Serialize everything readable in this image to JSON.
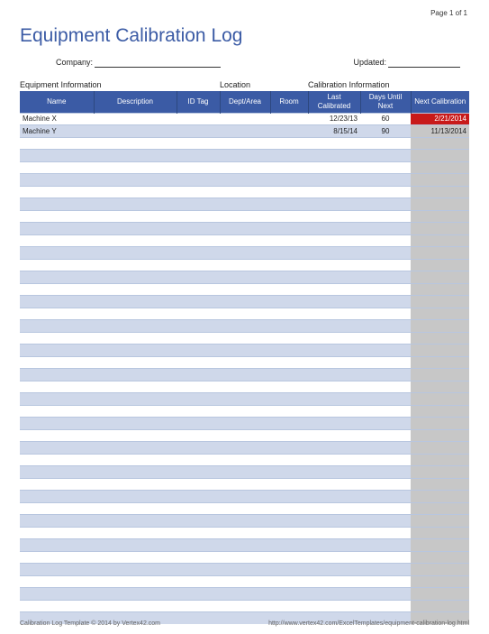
{
  "page_indicator": "Page 1 of 1",
  "title": "Equipment Calibration Log",
  "meta": {
    "company_label": "Company:",
    "updated_label": "Updated:"
  },
  "section_headers": {
    "equipment": "Equipment Information",
    "location": "Location",
    "calibration": "Calibration Information"
  },
  "columns": {
    "name": "Name",
    "description": "Description",
    "idtag": "ID Tag",
    "dept": "Dept/Area",
    "room": "Room",
    "last": "Last Calibrated",
    "days": "Days Until Next",
    "next": "Next Calibration"
  },
  "rows": [
    {
      "name": "Machine X",
      "description": "",
      "idtag": "",
      "dept": "",
      "room": "",
      "last": "12/23/13",
      "days": "60",
      "next": "2/21/2014",
      "overdue": true
    },
    {
      "name": "Machine Y",
      "description": "",
      "idtag": "",
      "dept": "",
      "room": "",
      "last": "8/15/14",
      "days": "90",
      "next": "11/13/2014",
      "overdue": false
    }
  ],
  "blank_rows": 40,
  "footer": {
    "left": "Calibration Log Template © 2014 by Vertex42.com",
    "right": "http://www.vertex42.com/ExcelTemplates/equipment-calibration-log.html"
  }
}
